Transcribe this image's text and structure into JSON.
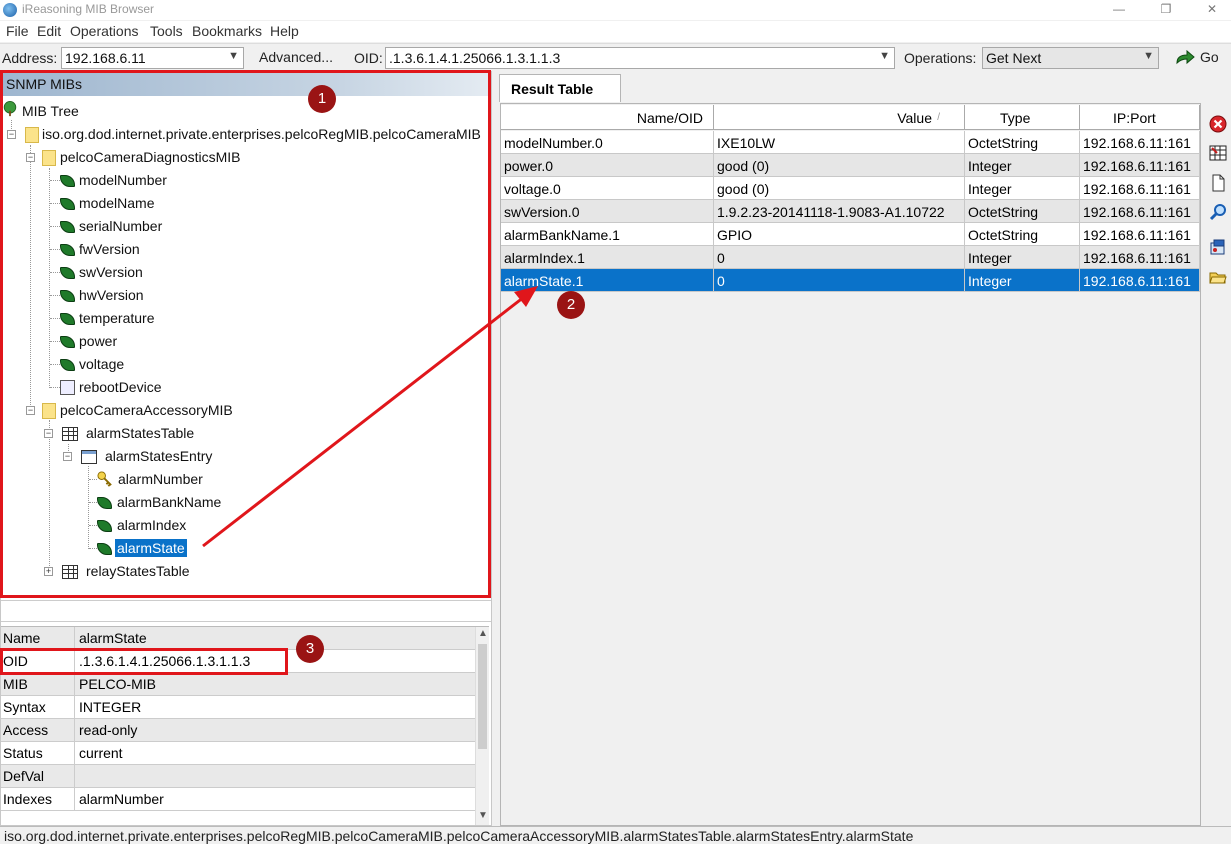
{
  "window": {
    "title": "iReasoning MIB Browser",
    "controls": [
      "—",
      "❐",
      "✕"
    ]
  },
  "menu": [
    "File",
    "Edit",
    "Operations",
    "Tools",
    "Bookmarks",
    "Help"
  ],
  "toolbar": {
    "address_label": "Address:",
    "address_value": "192.168.6.11",
    "advanced_label": "Advanced...",
    "oid_label": "OID:",
    "oid_value": ".1.3.6.1.4.1.25066.1.3.1.1.3",
    "operations_label": "Operations:",
    "operations_value": "Get Next",
    "go_label": "Go"
  },
  "tree": {
    "header": "SNMP MIBs",
    "root": "MIB Tree",
    "nodes": [
      "iso.org.dod.internet.private.enterprises.pelcoRegMIB.pelcoCameraMIB",
      "pelcoCameraDiagnosticsMIB",
      "modelNumber",
      "modelName",
      "serialNumber",
      "fwVersion",
      "swVersion",
      "hwVersion",
      "temperature",
      "power",
      "voltage",
      "rebootDevice",
      "pelcoCameraAccessoryMIB",
      "alarmStatesTable",
      "alarmStatesEntry",
      "alarmNumber",
      "alarmBankName",
      "alarmIndex",
      "alarmState",
      "relayStatesTable"
    ]
  },
  "properties": [
    {
      "name": "Name",
      "value": "alarmState"
    },
    {
      "name": "OID",
      "value": ".1.3.6.1.4.1.25066.1.3.1.1.3"
    },
    {
      "name": "MIB",
      "value": "PELCO-MIB"
    },
    {
      "name": "Syntax",
      "value": "INTEGER"
    },
    {
      "name": "Access",
      "value": "read-only"
    },
    {
      "name": "Status",
      "value": "current"
    },
    {
      "name": "DefVal",
      "value": ""
    },
    {
      "name": "Indexes",
      "value": "alarmNumber"
    }
  ],
  "result": {
    "tab_label": "Result Table",
    "columns": [
      "Name/OID",
      "Value",
      "Type",
      "IP:Port"
    ],
    "sort_indicator": "/",
    "rows": [
      [
        "modelNumber.0",
        "IXE10LW",
        "OctetString",
        "192.168.6.11:161"
      ],
      [
        "power.0",
        "good (0)",
        "Integer",
        "192.168.6.11:161"
      ],
      [
        "voltage.0",
        "good (0)",
        "Integer",
        "192.168.6.11:161"
      ],
      [
        "swVersion.0",
        "1.9.2.23-20141118-1.9083-A1.10722",
        "OctetString",
        "192.168.6.11:161"
      ],
      [
        "alarmBankName.1",
        "GPIO",
        "OctetString",
        "192.168.6.11:161"
      ],
      [
        "alarmIndex.1",
        "0",
        "Integer",
        "192.168.6.11:161"
      ],
      [
        "alarmState.1",
        "0",
        "Integer",
        "192.168.6.11:161"
      ]
    ]
  },
  "annotations": [
    "1",
    "2",
    "3"
  ],
  "status_bar": "iso.org.dod.internet.private.enterprises.pelcoRegMIB.pelcoCameraMIB.pelcoCameraAccessoryMIB.alarmStatesTable.alarmStatesEntry.alarmState",
  "colors": {
    "selection": "#0a72c9",
    "annotation_red": "#e0161b",
    "badge": "#9a1414"
  },
  "icons": [
    "tree-icon",
    "folder-icon",
    "leaf-icon",
    "pencil-icon",
    "table-icon",
    "entry-icon",
    "key-icon",
    "go-arrow-icon",
    "stop-icon",
    "grid-icon",
    "page-icon",
    "search-icon",
    "export-icon",
    "open-folder-icon"
  ]
}
